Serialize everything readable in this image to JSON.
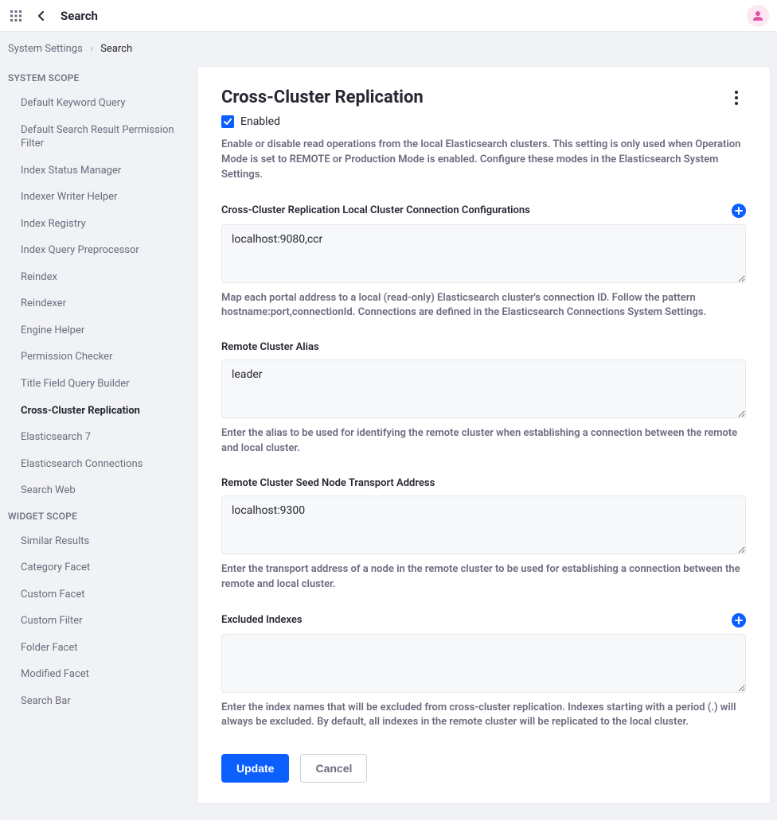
{
  "header": {
    "title": "Search"
  },
  "breadcrumb": {
    "parent": "System Settings",
    "current": "Search"
  },
  "sidebar": {
    "groups": [
      {
        "title": "SYSTEM SCOPE",
        "items": [
          "Default Keyword Query",
          "Default Search Result Permission Filter",
          "Index Status Manager",
          "Indexer Writer Helper",
          "Index Registry",
          "Index Query Preprocessor",
          "Reindex",
          "Reindexer",
          "Engine Helper",
          "Permission Checker",
          "Title Field Query Builder",
          "Cross-Cluster Replication",
          "Elasticsearch 7",
          "Elasticsearch Connections",
          "Search Web"
        ],
        "activeIndex": 11
      },
      {
        "title": "WIDGET SCOPE",
        "items": [
          "Similar Results",
          "Category Facet",
          "Custom Facet",
          "Custom Filter",
          "Folder Facet",
          "Modified Facet",
          "Search Bar"
        ],
        "activeIndex": -1
      }
    ]
  },
  "main": {
    "title": "Cross-Cluster Replication",
    "enabled_label": "Enabled",
    "enabled_checked": true,
    "description": "Enable or disable read operations from the local Elasticsearch clusters. This setting is only used when Operation Mode is set to REMOTE or Production Mode is enabled. Configure these modes in the Elasticsearch System Settings.",
    "fields": [
      {
        "label": "Cross-Cluster Replication Local Cluster Connection Configurations",
        "value": "localhost:9080,ccr",
        "help": "Map each portal address to a local (read-only) Elasticsearch cluster's connection ID. Follow the pattern hostname:port,connectionId. Connections are defined in the Elasticsearch Connections System Settings.",
        "has_add": true
      },
      {
        "label": "Remote Cluster Alias",
        "value": "leader",
        "help": "Enter the alias to be used for identifying the remote cluster when establishing a connection between the remote and local cluster.",
        "has_add": false
      },
      {
        "label": "Remote Cluster Seed Node Transport Address",
        "value": "localhost:9300",
        "help": "Enter the transport address of a node in the remote cluster to be used for establishing a connection between the remote and local cluster.",
        "has_add": false
      },
      {
        "label": "Excluded Indexes",
        "value": "",
        "help": "Enter the index names that will be excluded from cross-cluster replication. Indexes starting with a period (.) will always be excluded. By default, all indexes in the remote cluster will be replicated to the local cluster.",
        "has_add": true
      }
    ],
    "buttons": {
      "update": "Update",
      "cancel": "Cancel"
    }
  }
}
